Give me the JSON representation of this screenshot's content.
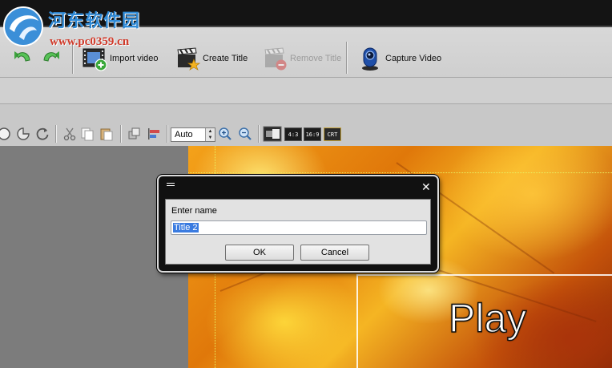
{
  "watermark": {
    "name": "河东软件园",
    "url": "www.pc0359.cn"
  },
  "toolbar": {
    "import_label": "Import video",
    "create_title_label": "Create Title",
    "remove_title_label": "Remove Title",
    "capture_label": "Capture Video"
  },
  "edit_bar": {
    "zoom_value": "Auto",
    "ratio_4_3": "4:3",
    "ratio_16_9": "16:9",
    "crt": "CRT"
  },
  "canvas": {
    "play_text": "Play"
  },
  "dialog": {
    "label": "Enter name",
    "input_value": "Title 2",
    "ok_label": "OK",
    "cancel_label": "Cancel",
    "close_glyph": "✕"
  },
  "colors": {
    "accent_selection": "#3a7be0",
    "titlebar": "#141414",
    "watermark_blue": "#2f8ad6",
    "watermark_red": "#d13a2a"
  }
}
